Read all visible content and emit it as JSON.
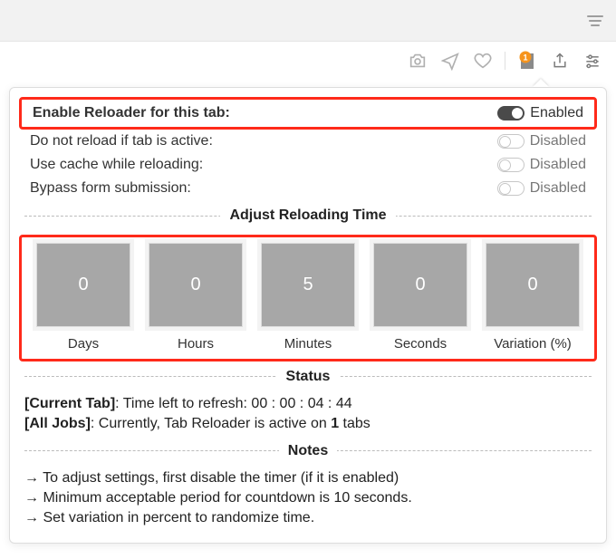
{
  "toolbar": {
    "ext_badge": "1"
  },
  "popup": {
    "settings": [
      {
        "label": "Enable Reloader for this tab:",
        "state": "Enabled",
        "on": true,
        "bold": true,
        "highlight": true
      },
      {
        "label": "Do not reload if tab is active:",
        "state": "Disabled",
        "on": false,
        "bold": false,
        "highlight": false
      },
      {
        "label": "Use cache while reloading:",
        "state": "Disabled",
        "on": false,
        "bold": false,
        "highlight": false
      },
      {
        "label": "Bypass form submission:",
        "state": "Disabled",
        "on": false,
        "bold": false,
        "highlight": false
      }
    ],
    "time_section_title": "Adjust Reloading Time",
    "time_units": [
      {
        "value": "0",
        "label": "Days"
      },
      {
        "value": "0",
        "label": "Hours"
      },
      {
        "value": "5",
        "label": "Minutes"
      },
      {
        "value": "0",
        "label": "Seconds"
      },
      {
        "value": "0",
        "label": "Variation (%)"
      }
    ],
    "status_section_title": "Status",
    "status": {
      "current_tab_prefix": "[Current Tab]",
      "current_tab_text": ": Time left to refresh: ",
      "current_tab_time": "00 : 00 : 04 : 44",
      "all_jobs_prefix": "[All Jobs]",
      "all_jobs_before": ": Currently, Tab Reloader is active on ",
      "all_jobs_count": "1",
      "all_jobs_after": " tabs"
    },
    "notes_section_title": "Notes",
    "notes": [
      "→ To adjust settings, first disable the timer (if it is enabled)",
      "→ Minimum acceptable period for countdown is 10 seconds.",
      "→ Set variation in percent to randomize time."
    ]
  }
}
